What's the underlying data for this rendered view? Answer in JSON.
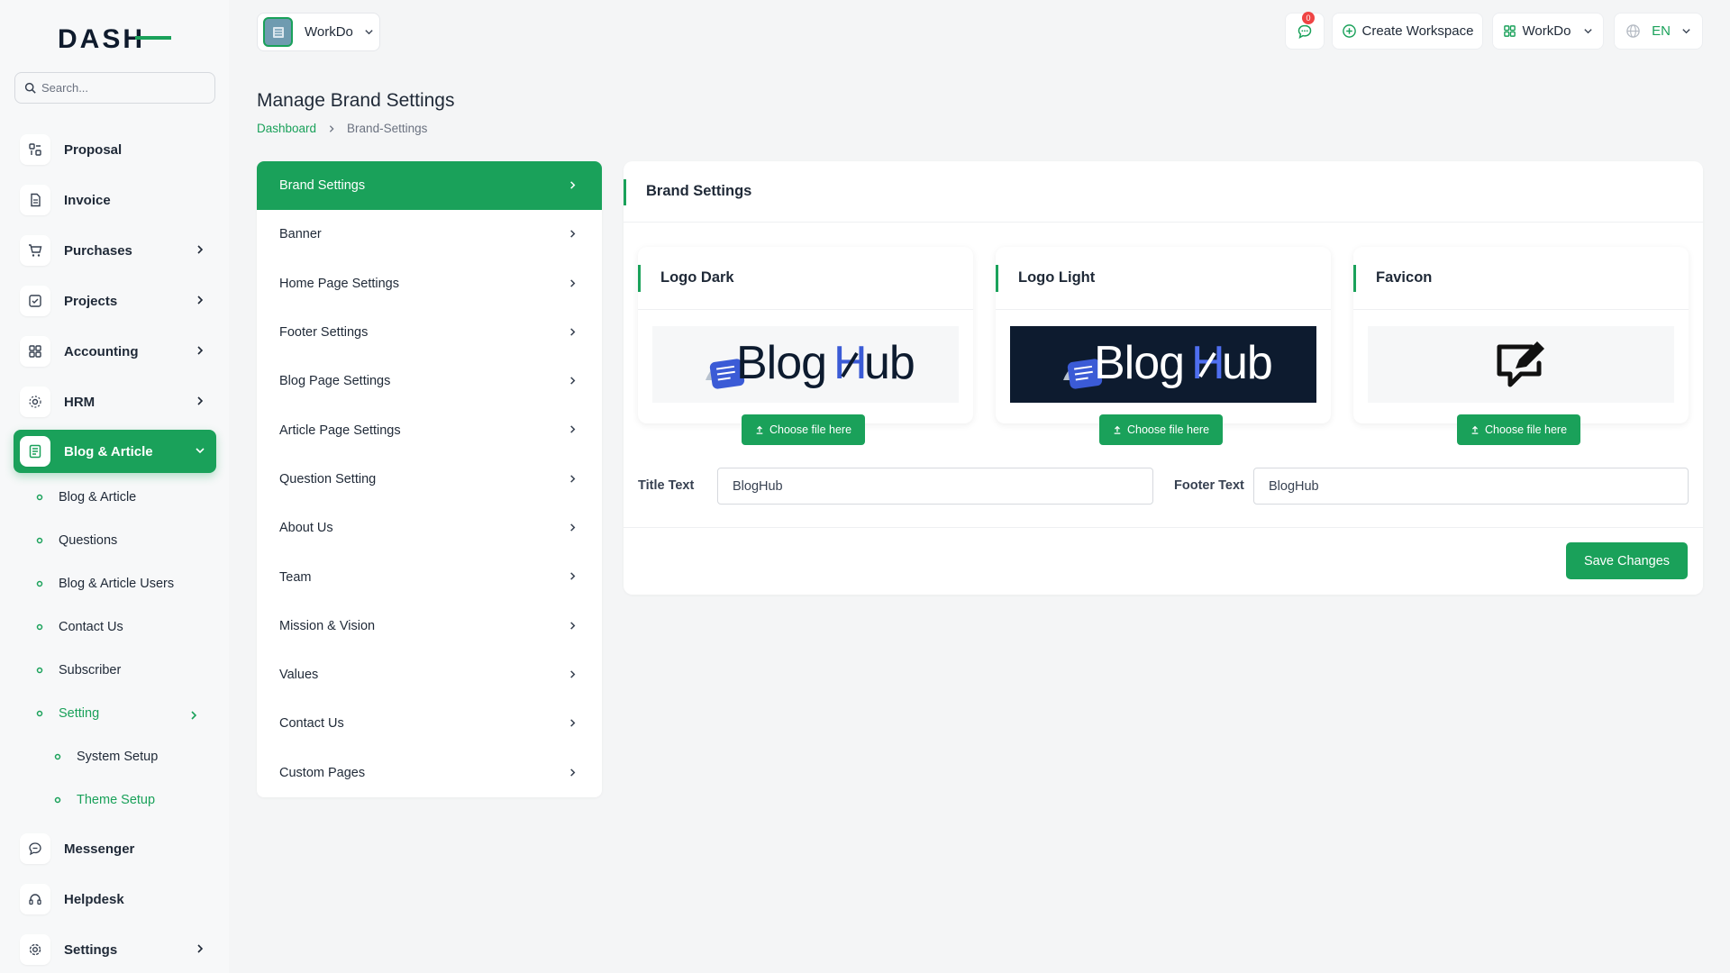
{
  "brand": {
    "logo_text": "DASH",
    "accent": "#1aa15a"
  },
  "search": {
    "placeholder": "Search..."
  },
  "sidebar": {
    "items": [
      {
        "label": "Proposal",
        "icon": "proposal-icon"
      },
      {
        "label": "Invoice",
        "icon": "invoice-icon"
      },
      {
        "label": "Purchases",
        "icon": "cart-icon"
      },
      {
        "label": "Projects",
        "icon": "projects-icon"
      },
      {
        "label": "Accounting",
        "icon": "accounting-icon"
      },
      {
        "label": "HRM",
        "icon": "hrm-icon"
      },
      {
        "label": "Blog & Article",
        "icon": "blog-icon"
      },
      {
        "label": "Messenger",
        "icon": "messenger-icon"
      },
      {
        "label": "Helpdesk",
        "icon": "headset-icon"
      },
      {
        "label": "Settings",
        "icon": "gear-icon"
      }
    ],
    "sub_items": [
      "Blog & Article",
      "Questions",
      "Blog & Article Users",
      "Contact Us",
      "Subscriber",
      "Setting"
    ],
    "setting_sub_items": [
      "System Setup",
      "Theme Setup"
    ]
  },
  "topbar": {
    "workspace_name": "WorkDo",
    "notification_count": "0",
    "create_workspace": "Create Workspace",
    "workspace_menu": "WorkDo",
    "language": "EN"
  },
  "page": {
    "title": "Manage Brand Settings",
    "breadcrumb": {
      "home": "Dashboard",
      "current": "Brand-Settings"
    }
  },
  "settings_menu": [
    "Brand Settings",
    "Banner",
    "Home Page Settings",
    "Footer Settings",
    "Blog Page Settings",
    "Article Page Settings",
    "Question Setting",
    "About Us",
    "Team",
    "Mission & Vision",
    "Values",
    "Contact Us",
    "Custom Pages"
  ],
  "brand_settings": {
    "title": "Brand Settings",
    "logo_dark": {
      "title": "Logo Dark",
      "button": "Choose file here"
    },
    "logo_light": {
      "title": "Logo Light",
      "button": "Choose file here"
    },
    "favicon": {
      "title": "Favicon",
      "button": "Choose file here"
    },
    "logo_text": {
      "blog": "Blog",
      "h": "H",
      "ub": "ub"
    },
    "title_text": {
      "label": "Title Text",
      "value": "BlogHub"
    },
    "footer_text": {
      "label": "Footer Text",
      "value": "BlogHub"
    },
    "save": "Save Changes"
  }
}
